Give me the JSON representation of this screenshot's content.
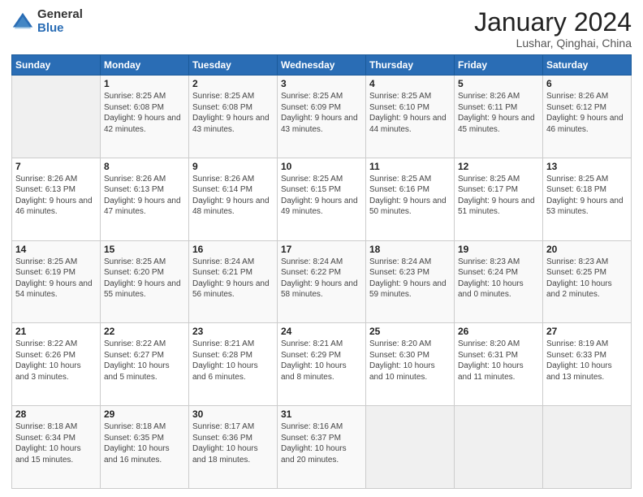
{
  "logo": {
    "general": "General",
    "blue": "Blue"
  },
  "title": {
    "month_year": "January 2024",
    "location": "Lushar, Qinghai, China"
  },
  "weekdays": [
    "Sunday",
    "Monday",
    "Tuesday",
    "Wednesday",
    "Thursday",
    "Friday",
    "Saturday"
  ],
  "weeks": [
    [
      {
        "day": "",
        "sunrise": "",
        "sunset": "",
        "daylight": ""
      },
      {
        "day": "1",
        "sunrise": "Sunrise: 8:25 AM",
        "sunset": "Sunset: 6:08 PM",
        "daylight": "Daylight: 9 hours and 42 minutes."
      },
      {
        "day": "2",
        "sunrise": "Sunrise: 8:25 AM",
        "sunset": "Sunset: 6:08 PM",
        "daylight": "Daylight: 9 hours and 43 minutes."
      },
      {
        "day": "3",
        "sunrise": "Sunrise: 8:25 AM",
        "sunset": "Sunset: 6:09 PM",
        "daylight": "Daylight: 9 hours and 43 minutes."
      },
      {
        "day": "4",
        "sunrise": "Sunrise: 8:25 AM",
        "sunset": "Sunset: 6:10 PM",
        "daylight": "Daylight: 9 hours and 44 minutes."
      },
      {
        "day": "5",
        "sunrise": "Sunrise: 8:26 AM",
        "sunset": "Sunset: 6:11 PM",
        "daylight": "Daylight: 9 hours and 45 minutes."
      },
      {
        "day": "6",
        "sunrise": "Sunrise: 8:26 AM",
        "sunset": "Sunset: 6:12 PM",
        "daylight": "Daylight: 9 hours and 46 minutes."
      }
    ],
    [
      {
        "day": "7",
        "sunrise": "Sunrise: 8:26 AM",
        "sunset": "Sunset: 6:13 PM",
        "daylight": "Daylight: 9 hours and 46 minutes."
      },
      {
        "day": "8",
        "sunrise": "Sunrise: 8:26 AM",
        "sunset": "Sunset: 6:13 PM",
        "daylight": "Daylight: 9 hours and 47 minutes."
      },
      {
        "day": "9",
        "sunrise": "Sunrise: 8:26 AM",
        "sunset": "Sunset: 6:14 PM",
        "daylight": "Daylight: 9 hours and 48 minutes."
      },
      {
        "day": "10",
        "sunrise": "Sunrise: 8:25 AM",
        "sunset": "Sunset: 6:15 PM",
        "daylight": "Daylight: 9 hours and 49 minutes."
      },
      {
        "day": "11",
        "sunrise": "Sunrise: 8:25 AM",
        "sunset": "Sunset: 6:16 PM",
        "daylight": "Daylight: 9 hours and 50 minutes."
      },
      {
        "day": "12",
        "sunrise": "Sunrise: 8:25 AM",
        "sunset": "Sunset: 6:17 PM",
        "daylight": "Daylight: 9 hours and 51 minutes."
      },
      {
        "day": "13",
        "sunrise": "Sunrise: 8:25 AM",
        "sunset": "Sunset: 6:18 PM",
        "daylight": "Daylight: 9 hours and 53 minutes."
      }
    ],
    [
      {
        "day": "14",
        "sunrise": "Sunrise: 8:25 AM",
        "sunset": "Sunset: 6:19 PM",
        "daylight": "Daylight: 9 hours and 54 minutes."
      },
      {
        "day": "15",
        "sunrise": "Sunrise: 8:25 AM",
        "sunset": "Sunset: 6:20 PM",
        "daylight": "Daylight: 9 hours and 55 minutes."
      },
      {
        "day": "16",
        "sunrise": "Sunrise: 8:24 AM",
        "sunset": "Sunset: 6:21 PM",
        "daylight": "Daylight: 9 hours and 56 minutes."
      },
      {
        "day": "17",
        "sunrise": "Sunrise: 8:24 AM",
        "sunset": "Sunset: 6:22 PM",
        "daylight": "Daylight: 9 hours and 58 minutes."
      },
      {
        "day": "18",
        "sunrise": "Sunrise: 8:24 AM",
        "sunset": "Sunset: 6:23 PM",
        "daylight": "Daylight: 9 hours and 59 minutes."
      },
      {
        "day": "19",
        "sunrise": "Sunrise: 8:23 AM",
        "sunset": "Sunset: 6:24 PM",
        "daylight": "Daylight: 10 hours and 0 minutes."
      },
      {
        "day": "20",
        "sunrise": "Sunrise: 8:23 AM",
        "sunset": "Sunset: 6:25 PM",
        "daylight": "Daylight: 10 hours and 2 minutes."
      }
    ],
    [
      {
        "day": "21",
        "sunrise": "Sunrise: 8:22 AM",
        "sunset": "Sunset: 6:26 PM",
        "daylight": "Daylight: 10 hours and 3 minutes."
      },
      {
        "day": "22",
        "sunrise": "Sunrise: 8:22 AM",
        "sunset": "Sunset: 6:27 PM",
        "daylight": "Daylight: 10 hours and 5 minutes."
      },
      {
        "day": "23",
        "sunrise": "Sunrise: 8:21 AM",
        "sunset": "Sunset: 6:28 PM",
        "daylight": "Daylight: 10 hours and 6 minutes."
      },
      {
        "day": "24",
        "sunrise": "Sunrise: 8:21 AM",
        "sunset": "Sunset: 6:29 PM",
        "daylight": "Daylight: 10 hours and 8 minutes."
      },
      {
        "day": "25",
        "sunrise": "Sunrise: 8:20 AM",
        "sunset": "Sunset: 6:30 PM",
        "daylight": "Daylight: 10 hours and 10 minutes."
      },
      {
        "day": "26",
        "sunrise": "Sunrise: 8:20 AM",
        "sunset": "Sunset: 6:31 PM",
        "daylight": "Daylight: 10 hours and 11 minutes."
      },
      {
        "day": "27",
        "sunrise": "Sunrise: 8:19 AM",
        "sunset": "Sunset: 6:33 PM",
        "daylight": "Daylight: 10 hours and 13 minutes."
      }
    ],
    [
      {
        "day": "28",
        "sunrise": "Sunrise: 8:18 AM",
        "sunset": "Sunset: 6:34 PM",
        "daylight": "Daylight: 10 hours and 15 minutes."
      },
      {
        "day": "29",
        "sunrise": "Sunrise: 8:18 AM",
        "sunset": "Sunset: 6:35 PM",
        "daylight": "Daylight: 10 hours and 16 minutes."
      },
      {
        "day": "30",
        "sunrise": "Sunrise: 8:17 AM",
        "sunset": "Sunset: 6:36 PM",
        "daylight": "Daylight: 10 hours and 18 minutes."
      },
      {
        "day": "31",
        "sunrise": "Sunrise: 8:16 AM",
        "sunset": "Sunset: 6:37 PM",
        "daylight": "Daylight: 10 hours and 20 minutes."
      },
      {
        "day": "",
        "sunrise": "",
        "sunset": "",
        "daylight": ""
      },
      {
        "day": "",
        "sunrise": "",
        "sunset": "",
        "daylight": ""
      },
      {
        "day": "",
        "sunrise": "",
        "sunset": "",
        "daylight": ""
      }
    ]
  ]
}
